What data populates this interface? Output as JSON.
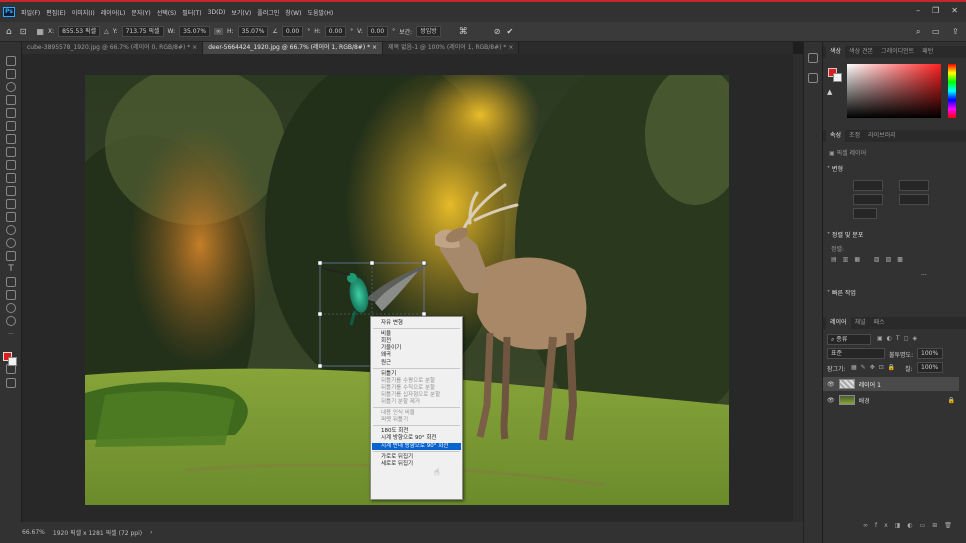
{
  "app": {
    "logo": "Ps"
  },
  "menu": [
    "파일(F)",
    "편집(E)",
    "이미지(I)",
    "레이어(L)",
    "문자(Y)",
    "선택(S)",
    "필터(T)",
    "3D(D)",
    "보기(V)",
    "플러그인",
    "창(W)",
    "도움말(H)"
  ],
  "options": {
    "x_label": "X:",
    "x_value": "855.53 픽셀",
    "y_label": "Y:",
    "y_value": "713.75 픽셀",
    "w_label": "W:",
    "w_value": "35.07%",
    "h_label": "H:",
    "h_value": "35.07%",
    "angle_value": "0.00",
    "hskew_label": "H:",
    "hskew_value": "0.00",
    "vskew_label": "V:",
    "vskew_value": "0.00",
    "interp_label": "보간:",
    "interp_value": "쌍입방"
  },
  "tabs": [
    "cube-3895578_1920.jpg @ 66.7% (레이어 0, RGB/8#) *",
    "deer-5664424_1920.jpg @ 66.7% (레이어 1, RGB/8#) *",
    "제목 없음-1 @ 100% (레이어 1, RGB/8#) *"
  ],
  "status": {
    "zoom": "66.67%",
    "doc": "1920 픽셀 x 1281 픽셀 (72 ppi)"
  },
  "colors": {
    "fg": "#e11b1b",
    "bg": "#f2f2f2",
    "accent": "#0a64cf"
  },
  "panels": {
    "color_tabs": [
      "색상",
      "색상 견본",
      "그레이디언트",
      "패턴"
    ],
    "props_tabs": [
      "속성",
      "조정",
      "라이브러리"
    ],
    "pixel_layer": "픽셀 레이어",
    "transform": "변형",
    "align_title": "정렬 및 분포",
    "align_label": "정렬:",
    "quick_actions": "빠른 작업",
    "layers_tabs": [
      "레이어",
      "채널",
      "패스"
    ],
    "layer_kind": "종류",
    "blend_mode": "표준",
    "opacity_label": "불투명도:",
    "opacity_value": "100%",
    "lock_label": "잠그기:",
    "fill_label": "칠:",
    "fill_value": "100%",
    "layers": [
      "레이어 1",
      "배경"
    ]
  },
  "context_menu": {
    "items": [
      {
        "label": "자유 변형",
        "state": "normal"
      },
      {
        "sep": true
      },
      {
        "label": "비율",
        "state": "normal"
      },
      {
        "label": "회전",
        "state": "normal"
      },
      {
        "label": "기울이기",
        "state": "normal"
      },
      {
        "label": "왜곡",
        "state": "normal"
      },
      {
        "label": "원근",
        "state": "normal"
      },
      {
        "sep": true
      },
      {
        "label": "뒤틀기",
        "state": "normal"
      },
      {
        "label": "뒤틀기를 수평으로 분할",
        "state": "disabled"
      },
      {
        "label": "뒤틀기를 수직으로 분할",
        "state": "disabled"
      },
      {
        "label": "뒤틀기를 십자형으로 분할",
        "state": "disabled"
      },
      {
        "label": "뒤틀기 분할 제거",
        "state": "disabled"
      },
      {
        "sep": true
      },
      {
        "label": "내용 인식 비율",
        "state": "disabled"
      },
      {
        "label": "퍼펫 뒤틀기",
        "state": "disabled"
      },
      {
        "sep": true
      },
      {
        "label": "180도 회전",
        "state": "normal"
      },
      {
        "label": "시계 방향으로 90° 회전",
        "state": "normal"
      },
      {
        "label": "시계 반대 방향으로 90° 회전",
        "state": "highlighted"
      },
      {
        "sep": true
      },
      {
        "label": "가로로 뒤집기",
        "state": "normal"
      },
      {
        "label": "세로로 뒤집기",
        "state": "normal"
      }
    ]
  }
}
